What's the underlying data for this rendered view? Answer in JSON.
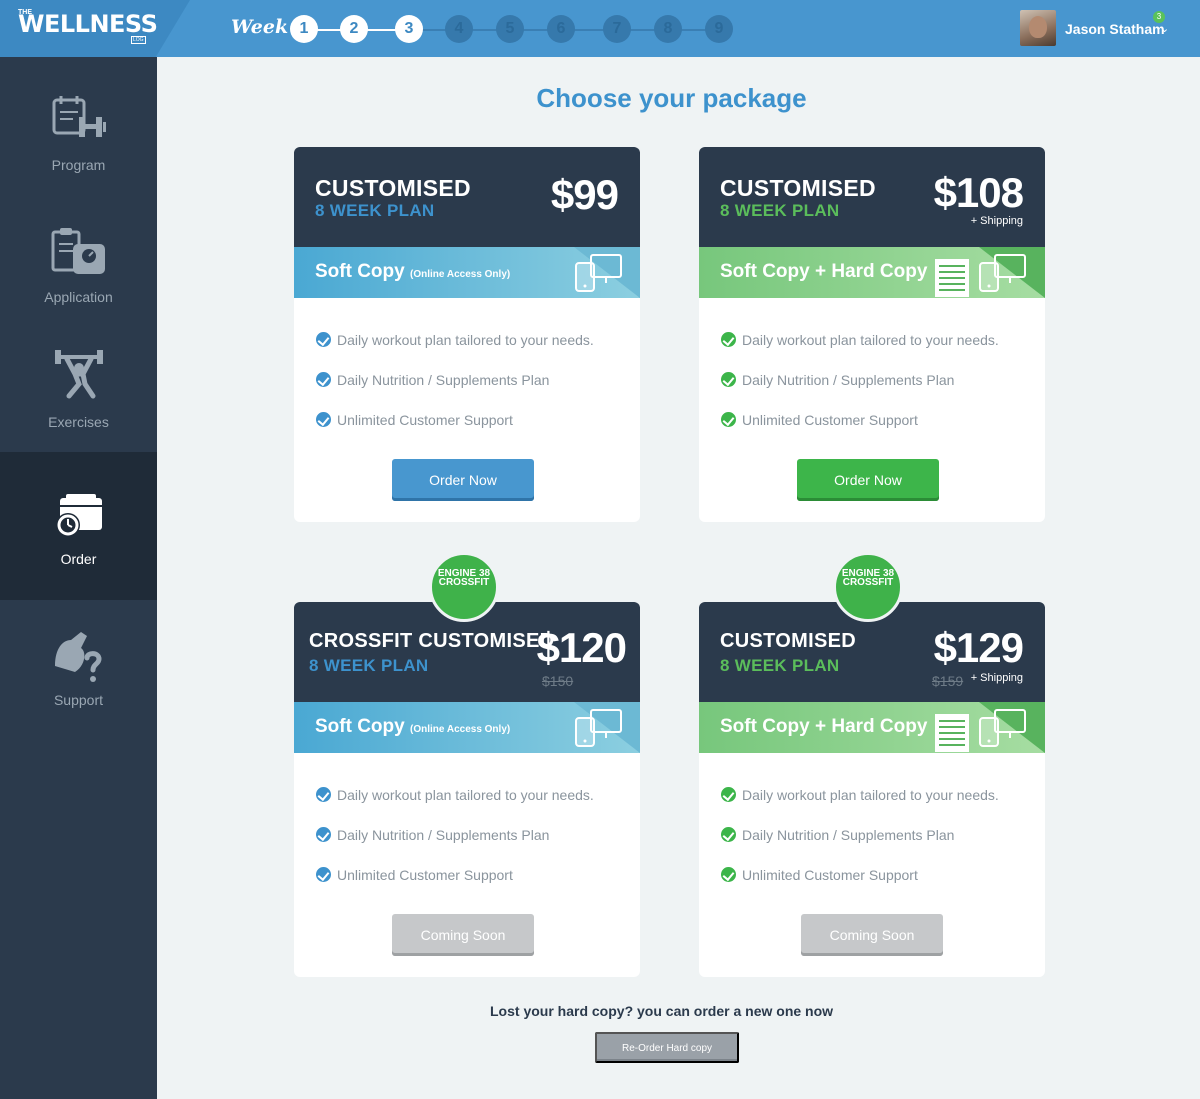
{
  "brand": {
    "the": "THE",
    "name": "WELLNESS",
    "log": "LOG"
  },
  "week": {
    "label": "Week",
    "steps": [
      "1",
      "2",
      "3",
      "4",
      "5",
      "6",
      "7",
      "8",
      "9"
    ],
    "current": 3
  },
  "user": {
    "name": "Jason Statham",
    "notifications": "3"
  },
  "sidebar": {
    "items": [
      {
        "label": "Program",
        "icon": "program-icon"
      },
      {
        "label": "Application",
        "icon": "application-icon"
      },
      {
        "label": "Exercises",
        "icon": "exercises-icon"
      },
      {
        "label": "Order",
        "icon": "order-icon",
        "active": true
      },
      {
        "label": "Support",
        "icon": "support-icon"
      }
    ]
  },
  "page": {
    "title": "Choose your package"
  },
  "features": [
    "Daily workout plan tailored to your needs.",
    "Daily Nutrition / Supplements Plan",
    "Unlimited Customer Support"
  ],
  "cards": [
    {
      "title": "CUSTOMISED",
      "subtitle": "8 WEEK PLAN",
      "price": "$99",
      "band": "Soft Copy",
      "band_note": "(Online Access Only)",
      "button": "Order Now"
    },
    {
      "title": "CUSTOMISED",
      "subtitle": "8 WEEK PLAN",
      "price": "$108",
      "shipping": "+ Shipping",
      "band": "Soft Copy + Hard Copy",
      "button": "Order Now"
    },
    {
      "title": "CROSSFIT CUSTOMISED",
      "subtitle": "8 WEEK PLAN",
      "price": "$120",
      "old_price": "$150",
      "band": "Soft Copy",
      "band_note": "(Online Access Only)",
      "button": "Coming Soon",
      "seal": "ENGINE 38 CROSSFIT"
    },
    {
      "title": "CUSTOMISED",
      "subtitle": "8 WEEK PLAN",
      "price": "$129",
      "old_price": "$159",
      "shipping": "+ Shipping",
      "band": "Soft Copy + Hard Copy",
      "button": "Coming Soon",
      "seal": "ENGINE 38 CROSSFIT"
    }
  ],
  "footer": {
    "text": "Lost your hard copy? you can order a new one now",
    "button": "Re-Order Hard copy"
  },
  "colors": {
    "primary": "#4896cf",
    "green": "#3db54a",
    "sidebar": "#2b3a4c",
    "background": "#eff3f4"
  }
}
